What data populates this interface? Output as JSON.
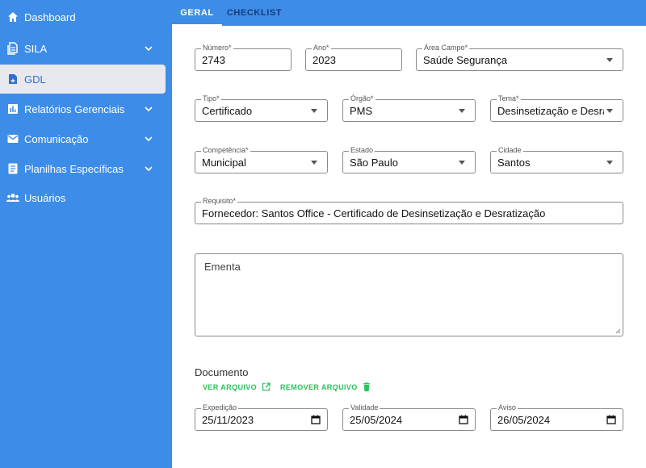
{
  "sidebar": {
    "items": [
      {
        "label": "Dashboard",
        "icon": "home-icon"
      },
      {
        "label": "SILA",
        "icon": "document-icon"
      },
      {
        "label": "GDL",
        "icon": "gdl-file-icon"
      },
      {
        "label": "Relatórios Gerenciais",
        "icon": "bar-chart-icon"
      },
      {
        "label": "Comunicação",
        "icon": "mail-icon"
      },
      {
        "label": "Planilhas Específicas",
        "icon": "sheet-icon"
      },
      {
        "label": "Usuários",
        "icon": "users-icon"
      }
    ]
  },
  "tabs": [
    {
      "label": "GERAL",
      "active": true
    },
    {
      "label": "CHECKLIST",
      "active": false
    }
  ],
  "form": {
    "numero": {
      "label": "Número*",
      "value": "2743"
    },
    "ano": {
      "label": "Ano*",
      "value": "2023"
    },
    "area_campo": {
      "label": "Área Campo*",
      "value": "Saúde Segurança"
    },
    "tipo": {
      "label": "Tipo*",
      "value": "Certificado"
    },
    "orgao": {
      "label": "Órgão*",
      "value": "PMS"
    },
    "tema": {
      "label": "Tema*",
      "value": "Desinsetização e Desra"
    },
    "competencia": {
      "label": "Competência*",
      "value": "Municipal"
    },
    "estado": {
      "label": "Estado",
      "value": "São Paulo"
    },
    "cidade": {
      "label": "Cidade",
      "value": "Santos"
    },
    "requisito": {
      "label": "Requisito*",
      "value": "Fornecedor: Santos Office - Certificado de Desinsetização e Desratização"
    },
    "ementa": {
      "placeholder": "Ementa"
    }
  },
  "documento": {
    "title": "Documento",
    "ver_label": "VER ARQUIVO",
    "remover_label": "REMOVER ARQUIVO"
  },
  "datas": {
    "expedicao": {
      "label": "Expedição",
      "value": "25/11/2023"
    },
    "validade": {
      "label": "Validade",
      "value": "25/05/2024"
    },
    "aviso": {
      "label": "Aviso",
      "value": "26/05/2024"
    }
  },
  "colors": {
    "primary": "#3d8de8",
    "accent_green": "#27c25c"
  }
}
